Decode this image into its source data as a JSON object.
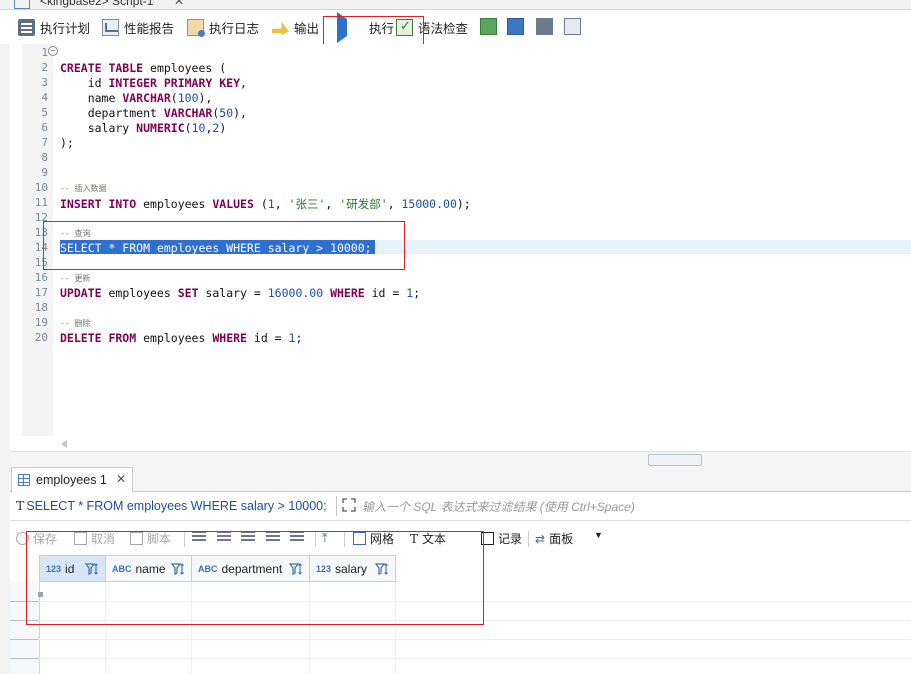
{
  "editor_tab": {
    "title": "<kingbase2> Script-1"
  },
  "toolbar": {
    "items": [
      {
        "label": "执行计划",
        "icon": "execution-plan-icon"
      },
      {
        "label": "性能报告",
        "icon": "performance-report-icon"
      },
      {
        "label": "执行日志",
        "icon": "execution-log-icon"
      },
      {
        "label": "输出",
        "icon": "output-icon"
      },
      {
        "label": "执行",
        "icon": "play-icon"
      },
      {
        "label": "语法检查",
        "icon": "syntax-check-icon"
      }
    ],
    "extra_icons": [
      "new-script-icon",
      "format-icon",
      "panel-icon",
      "edit-icon"
    ]
  },
  "editor": {
    "line_numbers": [
      "1",
      "2",
      "3",
      "4",
      "5",
      "6",
      "7",
      "8",
      "9",
      "10",
      "11",
      "12",
      "13",
      "14",
      "15",
      "16",
      "17",
      "18",
      "19",
      "20"
    ],
    "selected_line": "SELECT * FROM employees WHERE salary > 10000;",
    "comments": {
      "insert": "-- 插入数据",
      "query": "-- 查询",
      "update": "-- 更新",
      "delete": "-- 删除"
    }
  },
  "results": {
    "tab_label": "employees 1",
    "filter_query": "SELECT * FROM employees WHERE salary > 10000;",
    "filter_placeholder": "输入一个 SQL 表达式来过滤结果 (使用 Ctrl+Space)",
    "toolbar": {
      "save": "保存",
      "cancel": "取消",
      "script": "脚本",
      "grid": "网格",
      "text": "文本",
      "record": "记录",
      "panel": "面板"
    },
    "columns": [
      {
        "type": "123",
        "name": "id"
      },
      {
        "type": "ABC",
        "name": "name"
      },
      {
        "type": "ABC",
        "name": "department"
      },
      {
        "type": "123",
        "name": "salary"
      }
    ]
  },
  "colors": {
    "accent": "#2f6fcf",
    "highlight_box": "#e02020",
    "keyword": "#7f0055"
  }
}
